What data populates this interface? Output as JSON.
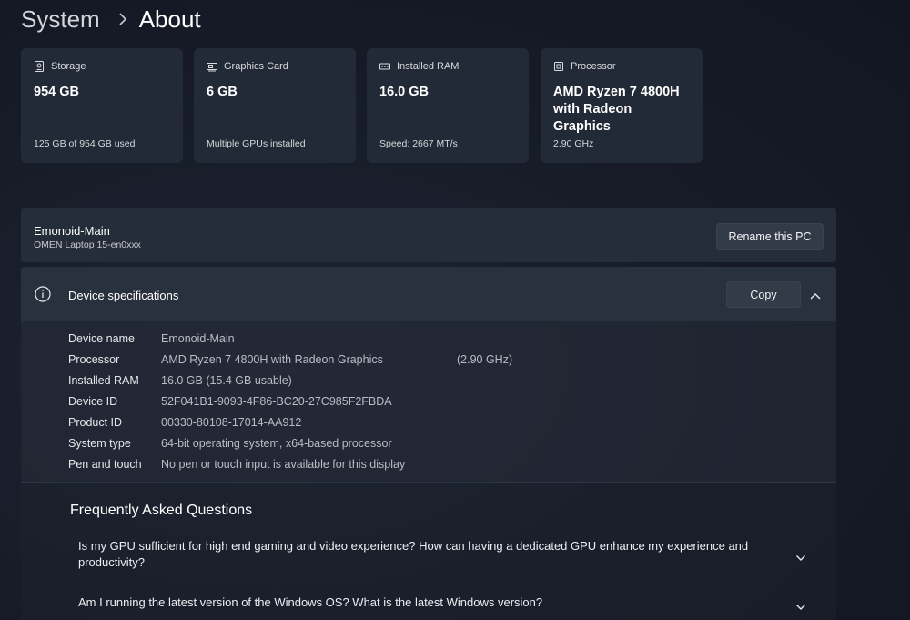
{
  "breadcrumb": {
    "parent": "System",
    "separator_icon": "chevron-right-icon",
    "current": "About"
  },
  "cards": [
    {
      "icon": "storage-icon",
      "title": "Storage",
      "value": "954 GB",
      "footer": "125 GB of 954 GB used"
    },
    {
      "icon": "graphics-card-icon",
      "title": "Graphics Card",
      "value": "6 GB",
      "footer": "Multiple GPUs installed"
    },
    {
      "icon": "ram-icon",
      "title": "Installed RAM",
      "value": "16.0 GB",
      "footer": "Speed: 2667 MT/s"
    },
    {
      "icon": "processor-icon",
      "title": "Processor",
      "value": "AMD Ryzen 7 4800H with Radeon Graphics",
      "footer": "2.90 GHz"
    }
  ],
  "pc": {
    "name": "Emonoid-Main",
    "model": "OMEN Laptop 15-en0xxx",
    "rename_label": "Rename this PC"
  },
  "device_specs": {
    "title": "Device specifications",
    "copy_label": "Copy",
    "rows": [
      {
        "label": "Device name",
        "value": "Emonoid-Main"
      },
      {
        "label": "Processor",
        "value": "AMD Ryzen 7 4800H with Radeon Graphics",
        "extra": "(2.90 GHz)"
      },
      {
        "label": "Installed RAM",
        "value": "16.0 GB (15.4 GB usable)"
      },
      {
        "label": "Device ID",
        "value": "52F041B1-9093-4F86-BC20-27C985F2FBDA"
      },
      {
        "label": "Product ID",
        "value": "00330-80108-17014-AA912"
      },
      {
        "label": "System type",
        "value": "64-bit operating system, x64-based processor"
      },
      {
        "label": "Pen and touch",
        "value": "No pen or touch input is available for this display"
      }
    ]
  },
  "faq": {
    "title": "Frequently Asked Questions",
    "questions": [
      "Is my GPU sufficient for high end gaming and video experience? How can having a dedicated GPU enhance my experience and productivity?",
      "Am I running the latest version of the Windows OS? What is the latest Windows version?"
    ]
  },
  "colors": {
    "background": "#161b27",
    "card": "#232a37",
    "panel": "#262d3a",
    "button": "#343b48",
    "text_primary": "#ffffff",
    "text_secondary": "#b9bcc3"
  }
}
